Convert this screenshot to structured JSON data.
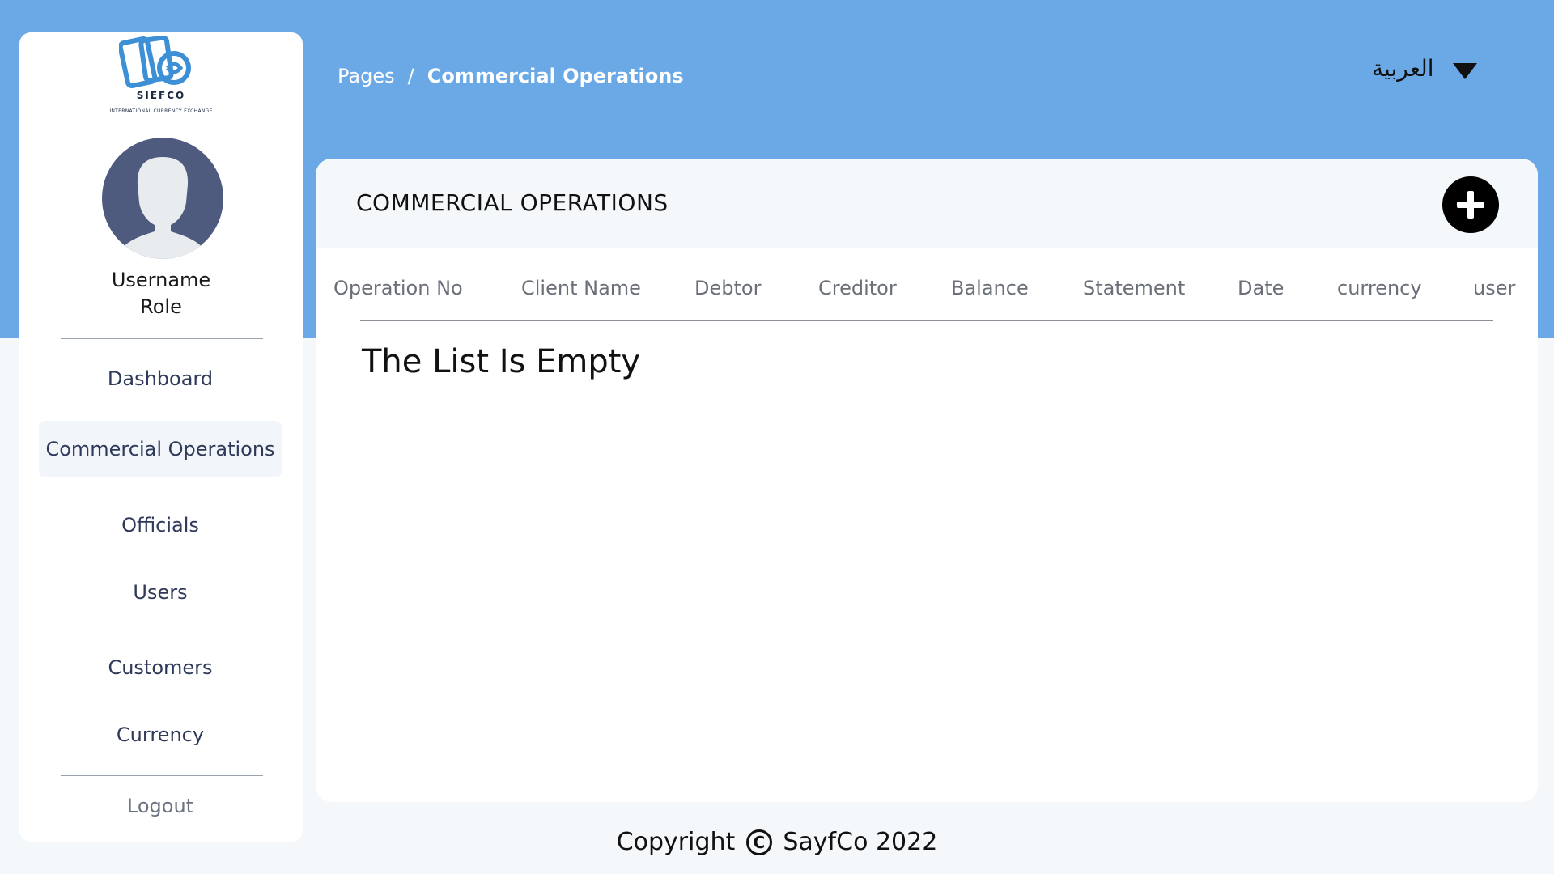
{
  "logo": {
    "name": "SIEFCO",
    "tagline": "INTERNATIONAL CURRENCY EXCHANGE"
  },
  "user": {
    "name": "Username",
    "role": "Role"
  },
  "sidebar": {
    "items": [
      {
        "label": "Dashboard"
      },
      {
        "label": "Commercial Operations",
        "active": true
      },
      {
        "label": "Officials"
      },
      {
        "label": "Users"
      },
      {
        "label": "Customers"
      },
      {
        "label": "Currency"
      }
    ],
    "logout_label": "Logout"
  },
  "breadcrumb": {
    "root": "Pages",
    "separator": "/",
    "current": "Commercial Operations"
  },
  "language": {
    "label": "العربية"
  },
  "main": {
    "title": "COMMERCIAL OPERATIONS",
    "columns": [
      "Operation No",
      "Client Name",
      "Debtor",
      "Creditor",
      "Balance",
      "Statement",
      "Date",
      "currency",
      "user"
    ],
    "empty_message": "The List Is Empty"
  },
  "footer": {
    "prefix": "Copyright",
    "symbol": "C",
    "suffix": "SayfCo 2022"
  },
  "colors": {
    "header_band": "#6aa9e6",
    "avatar": "#4e5a7e",
    "logo_blue": "#3d8fd6",
    "add_button": "#000000"
  }
}
